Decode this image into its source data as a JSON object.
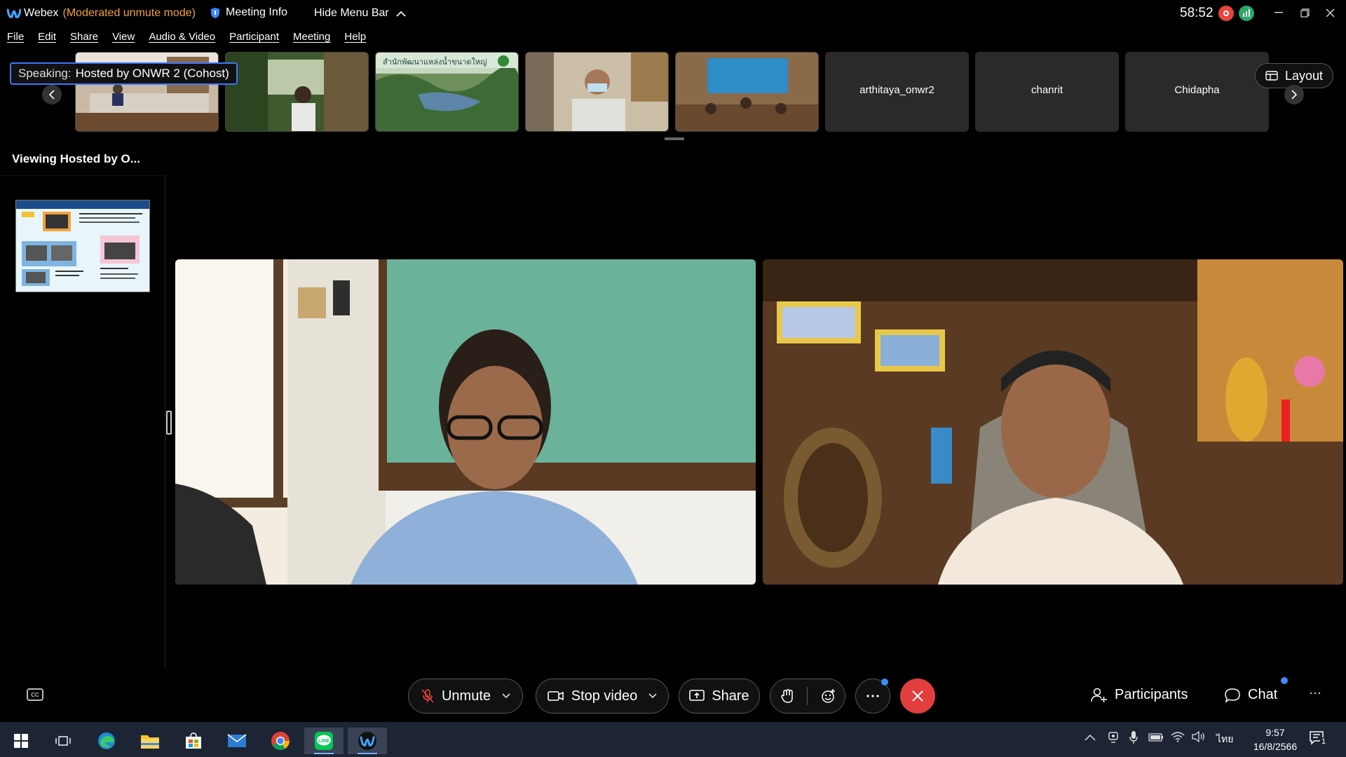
{
  "titlebar": {
    "app_name": "Webex",
    "mode": "(Moderated unmute mode)",
    "meeting_info": "Meeting Info",
    "hide_menu_bar": "Hide Menu Bar",
    "timer": "58:52"
  },
  "menu": [
    "File",
    "Edit",
    "Share",
    "View",
    "Audio & Video",
    "Participant",
    "Meeting",
    "Help"
  ],
  "filmstrip": {
    "speaking_label": "Speaking:",
    "speaking_name": "Hosted by ONWR 2 (Cohost)",
    "banner_text": "สำนักพัฒนาแหล่งน้ำขนาดใหญ่",
    "participants": [
      "arthitaya_onwr2",
      "chanrit",
      "Chidapha"
    ],
    "layout_label": "Layout"
  },
  "viewing": "Viewing Hosted by O...",
  "controls": {
    "unmute": "Unmute",
    "stop_video": "Stop video",
    "share": "Share",
    "participants": "Participants",
    "chat": "Chat"
  },
  "taskbar": {
    "language": "ไทย",
    "time": "9:57",
    "date": "16/8/2566",
    "notification_count": "1"
  },
  "colors": {
    "accent_blue": "#3b77ff",
    "end_red": "#e23e3e",
    "mode_orange": "#f2a33a",
    "taskbar": "#1d2434"
  }
}
